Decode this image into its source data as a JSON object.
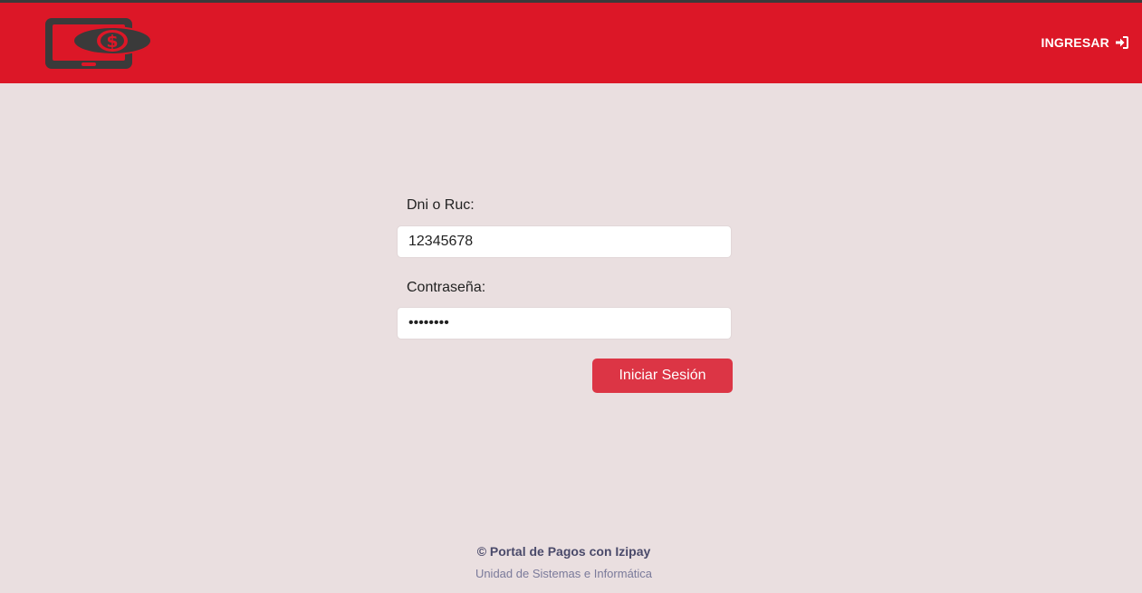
{
  "header": {
    "logo_icon": "mobile-payment-icon",
    "login_label": "INGRESAR",
    "login_icon": "sign-in-icon",
    "brand_color": "#dc1727"
  },
  "form": {
    "dni_label": "Dni o Ruc:",
    "dni_value": "12345678",
    "password_label": "Contraseña:",
    "password_value": "••••••••",
    "submit_label": "Iniciar Sesión",
    "button_color": "#dc3545"
  },
  "footer": {
    "copyright": "© Portal de Pagos con Izipay",
    "unit": "Unidad de Sistemas e Informática"
  }
}
